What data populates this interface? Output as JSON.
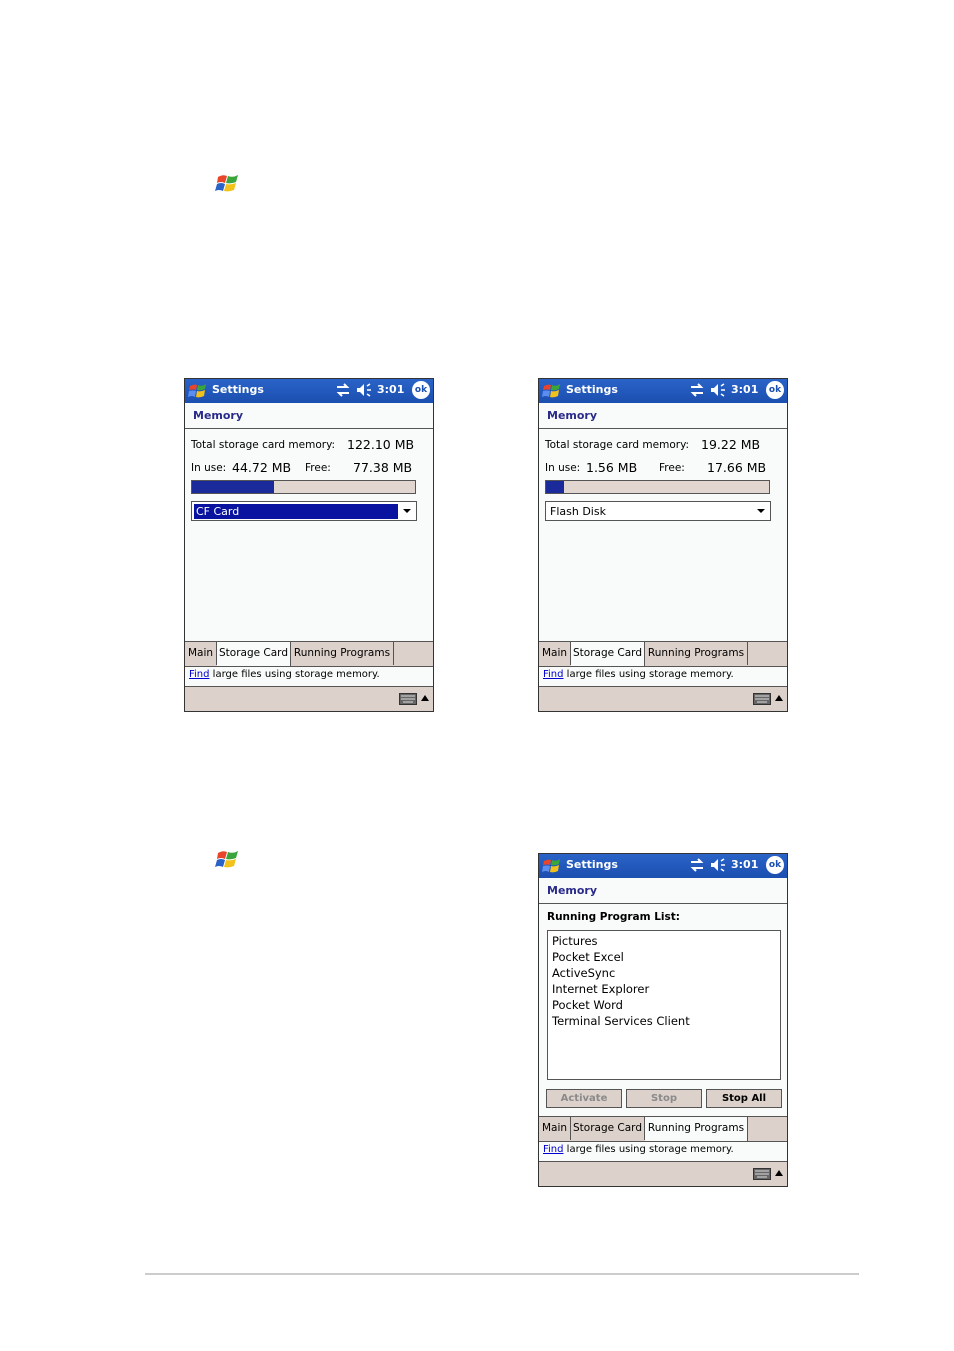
{
  "window_title": "Settings",
  "clock": "3:01",
  "ok_label": "ok",
  "page_header": "Memory",
  "screens": {
    "cf": {
      "total_label": "Total storage card memory:",
      "total_value": "122.10 MB",
      "inuse_label": "In use:",
      "inuse_value": "44.72 MB",
      "free_label": "Free:",
      "free_value": "77.38 MB",
      "usage_fraction": 0.366,
      "selected_card": "CF Card"
    },
    "flash": {
      "total_label": "Total storage card memory:",
      "total_value": "19.22 MB",
      "inuse_label": "In use:",
      "inuse_value": "1.56 MB",
      "free_label": "Free:",
      "free_value": "17.66 MB",
      "usage_fraction": 0.081,
      "selected_card": "Flash Disk"
    },
    "running": {
      "list_title": "Running Program List:",
      "programs": [
        "Pictures",
        "Pocket Excel",
        "ActiveSync",
        "Internet Explorer",
        "Pocket Word",
        "Terminal Services Client"
      ],
      "buttons": {
        "activate": "Activate",
        "stop": "Stop",
        "stop_all": "Stop All"
      }
    }
  },
  "tabs": {
    "main": "Main",
    "storage": "Storage Card",
    "running": "Running Programs"
  },
  "find": {
    "link": "Find",
    "rest": " large files using storage memory."
  },
  "colors": {
    "titlebar": "#1b4fb0",
    "bar_fill": "#1a2a9a",
    "chrome": "#ddd1cb",
    "header_text": "#2a2a8a"
  },
  "icons": [
    "windows-start-icon",
    "sync-icon",
    "speaker-icon",
    "ok-icon",
    "dropdown-arrow-icon",
    "keyboard-icon",
    "sip-up-arrow-icon"
  ]
}
